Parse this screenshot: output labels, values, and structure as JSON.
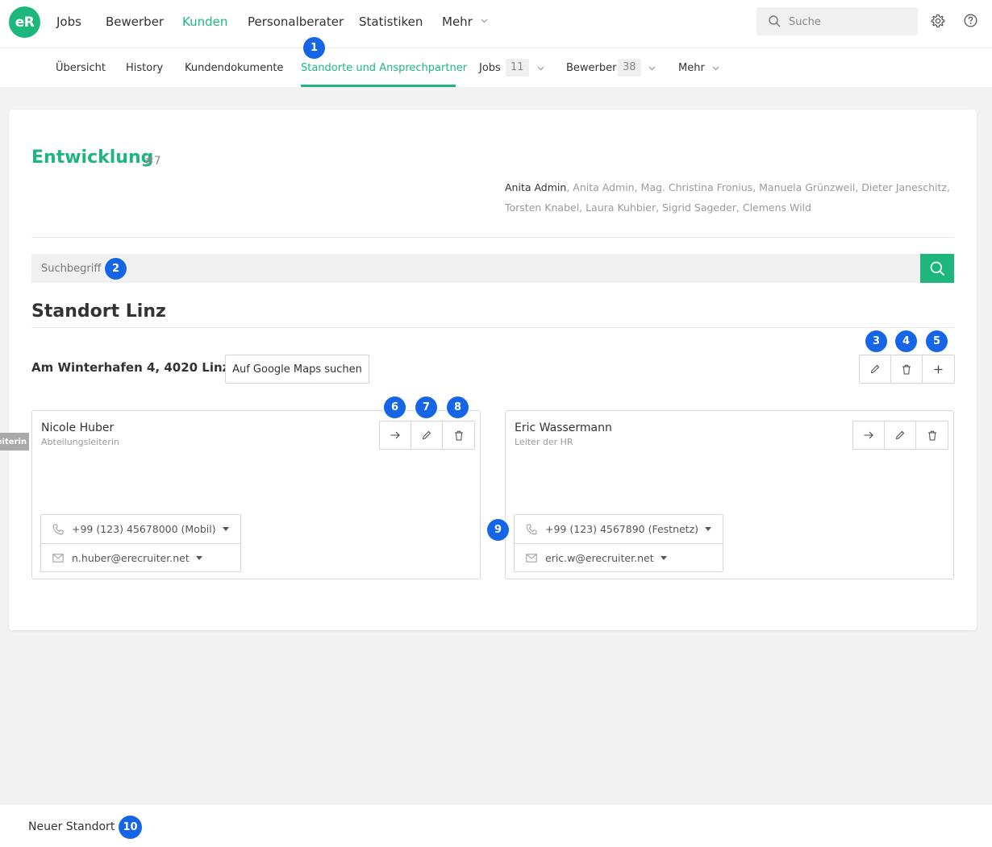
{
  "logo": "eR",
  "nav": {
    "items": [
      "Jobs",
      "Bewerber",
      "Kunden",
      "Personalberater",
      "Statistiken",
      "Mehr"
    ],
    "active": "Kunden"
  },
  "search": {
    "placeholder": "Suche"
  },
  "subnav": {
    "overview": "Übersicht",
    "history": "History",
    "docs": "Kundendokumente",
    "locations": "Standorte und Ansprechpartner",
    "jobs": "Jobs",
    "jobs_count": "11",
    "applicants": "Bewerber",
    "applicants_count": "38",
    "more": "Mehr"
  },
  "page": {
    "title": "Entwicklung",
    "number": "#7",
    "owner_primary": "Anita Admin",
    "owners_rest": ", Anita Admin, Mag. Christina Fronius, Manuela Grünzweil, Dieter Janeschitz, Torsten Knabel, Laura Kuhbier, Sigrid Sageder, Clemens Wild"
  },
  "filter": {
    "placeholder": "Suchbegriff"
  },
  "location": {
    "title": "Standort Linz",
    "address": "Am Winterhafen 4, 4020 Linz",
    "maps_button": "Auf Google Maps suchen"
  },
  "contacts": [
    {
      "name": "Nicole Huber",
      "role": "Abteilungsleiterin",
      "phone": "+99 (123) 45678000 (Mobil)",
      "email": "n.huber@erecruiter.net"
    },
    {
      "name": "Eric Wassermann",
      "role": "Leiter der HR",
      "phone": "+99 (123) 4567890 (Festnetz)",
      "email": "eric.w@erecruiter.net"
    }
  ],
  "tooltip": "Abteilungsleiterin",
  "footer": {
    "new_location": "Neuer Standort"
  },
  "badges": [
    "1",
    "2",
    "3",
    "4",
    "5",
    "6",
    "7",
    "8",
    "9",
    "10"
  ],
  "colors": {
    "brand": "#1db77e",
    "badge": "#1565e6"
  }
}
